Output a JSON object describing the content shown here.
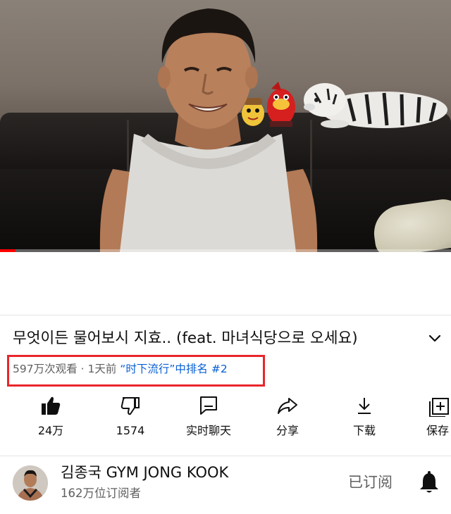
{
  "video": {
    "title": "무엇이든 물어보시 지효.. (feat. 마녀식당으로 오세요)",
    "progress": 0.035
  },
  "meta": {
    "views": "597万次观看",
    "separator": "·",
    "age": "1天前",
    "trending": "“时下流行”中排名 #2"
  },
  "actions": {
    "like": {
      "label": "24万",
      "icon": "thumbs-up-filled-icon"
    },
    "dislike": {
      "label": "1574",
      "icon": "thumbs-down-icon"
    },
    "live_chat": {
      "label": "实时聊天",
      "icon": "chat-icon"
    },
    "share": {
      "label": "分享",
      "icon": "share-arrow-icon"
    },
    "download": {
      "label": "下载",
      "icon": "download-icon"
    },
    "save": {
      "label": "保存",
      "icon": "playlist-add-icon"
    }
  },
  "channel": {
    "name": "김종국 GYM JONG KOOK",
    "subscribers": "162万位订阅者",
    "subscribe_state": "已订阅"
  },
  "colors": {
    "highlight_box": "#e8262b",
    "trending_link": "#065fd4",
    "progress": "#ff0000"
  }
}
